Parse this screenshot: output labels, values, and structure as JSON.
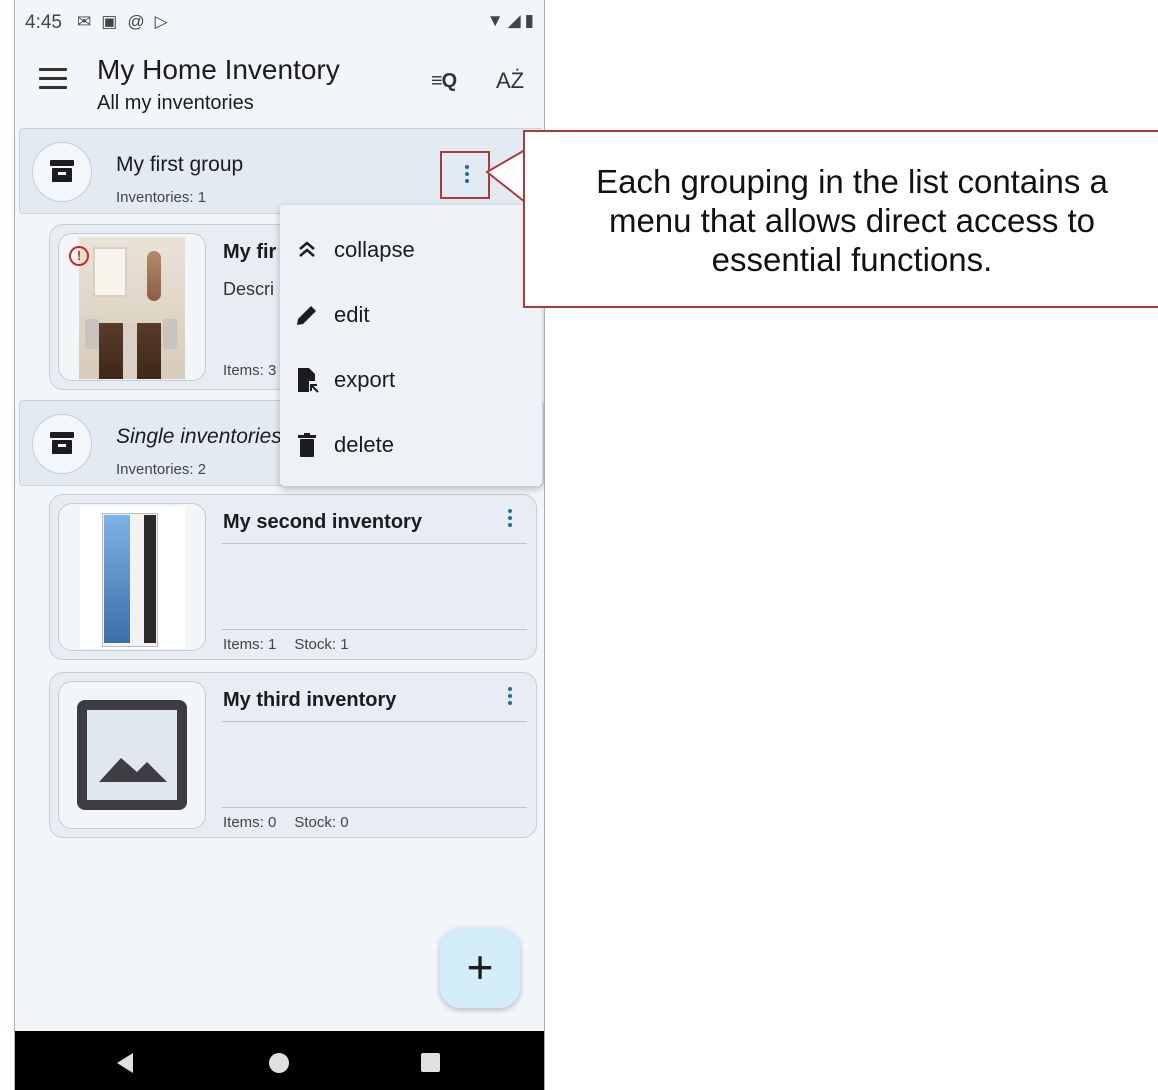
{
  "status_bar": {
    "time": "4:45",
    "left_icons": [
      "gmail-icon",
      "notification-icon",
      "at-icon",
      "play-icon"
    ],
    "right_icons": [
      "wifi-icon",
      "signal-icon",
      "battery-icon"
    ]
  },
  "app_bar": {
    "title": "My Home Inventory",
    "subtitle": "All my inventories",
    "menu_icon": "hamburger-icon",
    "filter_icon": "filter-search-icon",
    "sort_label": "AŻ"
  },
  "groups": [
    {
      "name": "My first group",
      "count_label": "Inventories: 1",
      "icon": "archive-box-icon"
    },
    {
      "name": "Single inventories",
      "count_label": "Inventories: 2",
      "icon": "archive-box-icon"
    }
  ],
  "inventories": [
    {
      "name": "My fir",
      "description": "Descri",
      "items": "Items: 3",
      "stock": "",
      "image": "room-photo",
      "alert": "!"
    },
    {
      "name": "My second inventory",
      "description": "",
      "items": "Items: 1",
      "stock": "Stock: 1",
      "image": "pc-case-photo"
    },
    {
      "name": "My third inventory",
      "description": "",
      "items": "Items: 0",
      "stock": "Stock: 0",
      "image": "placeholder-image-icon"
    }
  ],
  "popup_menu": {
    "items": [
      {
        "label": "collapse",
        "icon": "double-chevron-up-icon"
      },
      {
        "label": "edit",
        "icon": "pencil-icon"
      },
      {
        "label": "export",
        "icon": "file-export-icon"
      },
      {
        "label": "delete",
        "icon": "trash-icon"
      }
    ]
  },
  "fab": {
    "label": "+",
    "icon": "plus-icon"
  },
  "callout": {
    "text": "Each grouping in the list contains a menu that allows direct access to essential functions."
  },
  "colors": {
    "accent": "#1f6d9c",
    "highlight_border": "#b03a3a",
    "group_background": "#e3ebf2",
    "card_background": "#e7edf2",
    "fab_background": "#d3edf9"
  }
}
